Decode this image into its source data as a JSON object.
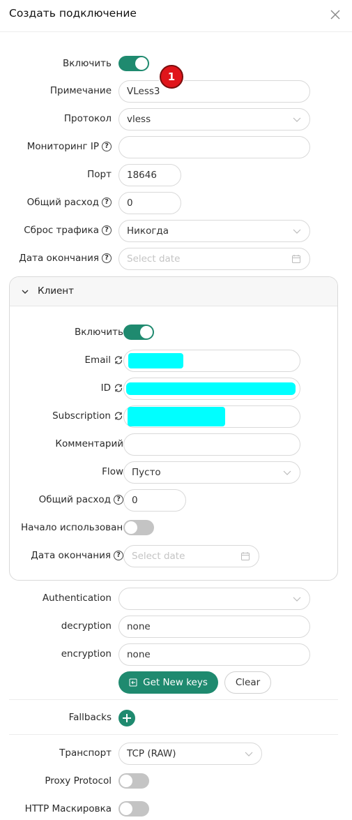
{
  "header": {
    "title": "Создать подключение"
  },
  "form": {
    "enable_label": "Включить",
    "enable_on": true,
    "remark_label": "Примечание",
    "remark_value": "VLess3",
    "badge": "1",
    "protocol_label": "Протокол",
    "protocol_value": "vless",
    "monitor_label": "Мониторинг IP",
    "monitor_value": "",
    "port_label": "Порт",
    "port_value": "18646",
    "total_label": "Общий расход",
    "total_value": "0",
    "reset_label": "Сброс трафика",
    "reset_value": "Никогда",
    "expiry_label": "Дата окончания",
    "expiry_placeholder": "Select date"
  },
  "client": {
    "title": "Клиент",
    "enable_label": "Включить",
    "enable_on": true,
    "email_label": "Email",
    "id_label": "ID",
    "subscription_label": "Subscription",
    "comment_label": "Комментарий",
    "comment_value": "",
    "flow_label": "Flow",
    "flow_value": "Пусто",
    "total_label": "Общий расход",
    "total_value": "0",
    "start_label": "Начало использования",
    "start_on": false,
    "expiry_label": "Дата окончания",
    "expiry_placeholder": "Select date"
  },
  "security": {
    "auth_label": "Authentication",
    "auth_value": "",
    "decryption_label": "decryption",
    "decryption_value": "none",
    "encryption_label": "encryption",
    "encryption_value": "none",
    "get_keys_label": "Get New keys",
    "clear_label": "Clear"
  },
  "fallbacks": {
    "label": "Fallbacks"
  },
  "transport": {
    "label": "Транспорт",
    "value": "TCP (RAW)",
    "proxy_label": "Proxy Protocol",
    "proxy_on": false,
    "http_label": "HTTP Маскировка",
    "http_on": false
  },
  "colors": {
    "accent": "#1f8a6f",
    "redaction": "#00ffff",
    "badge": "#e0151b"
  }
}
